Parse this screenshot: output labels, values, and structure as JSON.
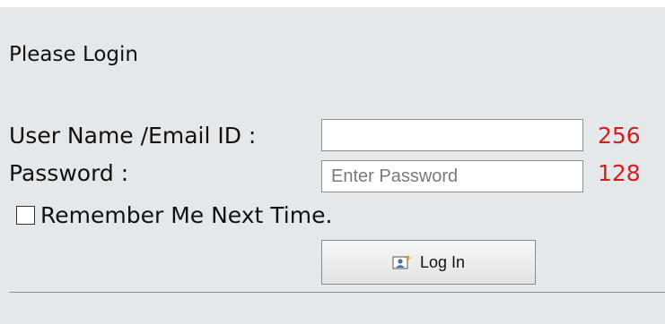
{
  "form": {
    "title": "Please Login",
    "username": {
      "label": "User Name /Email ID :",
      "value": "",
      "placeholder": "",
      "max_length_counter": "256"
    },
    "password": {
      "label": "Password :",
      "value": "",
      "placeholder": "Enter Password",
      "max_length_counter": "128"
    },
    "remember_me": {
      "label": "Remember Me Next Time.",
      "checked": false
    },
    "login_button": {
      "label": "Log In",
      "icon": "user-card-login-icon"
    }
  },
  "colors": {
    "panel_background": "#e5e8ea",
    "counter_text": "#d1201f",
    "input_border": "#8d8d8d"
  }
}
